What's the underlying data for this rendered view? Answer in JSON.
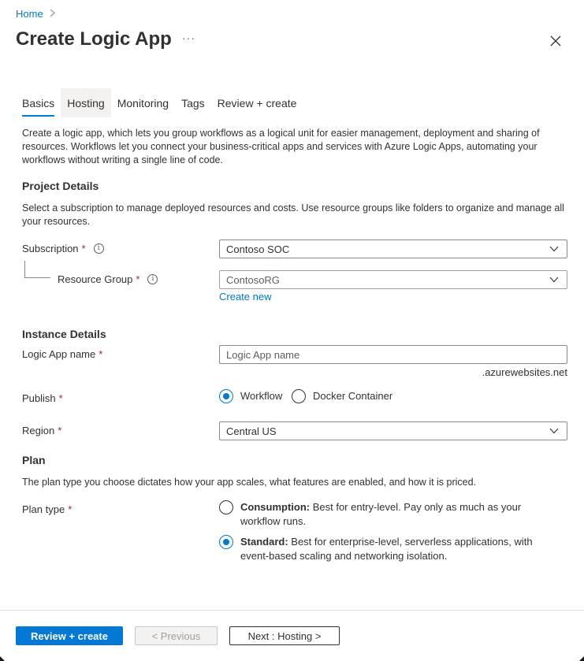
{
  "breadcrumb": {
    "home": "Home",
    "separator": ">"
  },
  "header": {
    "title": "Create Logic App",
    "more": "···"
  },
  "tabs": [
    {
      "label": "Basics",
      "active": true
    },
    {
      "label": "Hosting",
      "active": false
    },
    {
      "label": "Monitoring",
      "active": false
    },
    {
      "label": "Tags",
      "active": false
    },
    {
      "label": "Review + create",
      "active": false
    }
  ],
  "intro": "Create a logic app, which lets you group workflows as a logical unit for easier management, deployment and sharing of resources. Workflows let you connect your business-critical apps and services with Azure Logic Apps, automating your workflows without writing a single line of code.",
  "project": {
    "heading": "Project Details",
    "description": "Select a subscription to manage deployed resources and costs. Use resource groups like folders to organize and manage all your resources.",
    "subscription": {
      "label": "Subscription",
      "required": "*",
      "value": "Contoso SOC"
    },
    "resource_group": {
      "label": "Resource Group",
      "required": "*",
      "value": "ContosoRG",
      "create_new": "Create new"
    }
  },
  "instance": {
    "heading": "Instance Details",
    "name": {
      "label": "Logic App name",
      "required": "*",
      "value": "",
      "placeholder": "Logic App name",
      "suffix": ".azurewebsites.net"
    },
    "publish": {
      "label": "Publish",
      "required": "*",
      "options": [
        "Workflow",
        "Docker Container"
      ],
      "selected": "Workflow"
    },
    "region": {
      "label": "Region",
      "required": "*",
      "value": "Central US"
    }
  },
  "plan": {
    "heading": "Plan",
    "description": "The plan type you choose dictates how your app scales, what features are enabled, and how it is priced.",
    "label": "Plan type",
    "required": "*",
    "options": [
      {
        "name": "Consumption:",
        "text": " Best for entry-level. Pay only as much as your workflow runs.",
        "selected": false
      },
      {
        "name": "Standard:",
        "text": " Best for enterprise-level, serverless applications, with event-based scaling and networking isolation.",
        "selected": true
      }
    ]
  },
  "footer": {
    "review_create": "Review + create",
    "previous": "< Previous",
    "next": "Next : Hosting >"
  },
  "colors": {
    "accent": "#0078d4",
    "required": "#a4262c",
    "text": "#323130"
  }
}
